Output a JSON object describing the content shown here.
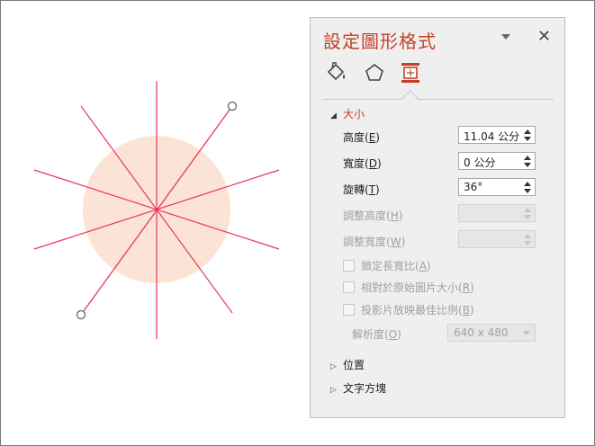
{
  "pane": {
    "title": "設定圖形格式",
    "menu_icon": "chevron-down-icon",
    "close_label": "✕"
  },
  "tabs": [
    {
      "name": "fill-line-icon"
    },
    {
      "name": "effects-pentagon-icon"
    },
    {
      "name": "size-properties-icon",
      "active": true
    }
  ],
  "sections": {
    "size": {
      "label": "大小",
      "height": {
        "label_prefix": "高度(",
        "key": "E",
        "label_suffix": ")",
        "value": "11.04 公分"
      },
      "width": {
        "label_prefix": "寬度(",
        "key": "D",
        "label_suffix": ")",
        "value": "0 公分"
      },
      "rotation": {
        "label_prefix": "旋轉(",
        "key": "T",
        "label_suffix": ")",
        "value": "36°"
      },
      "scale_height": {
        "label_prefix": "調整高度(",
        "key": "H",
        "label_suffix": ")",
        "value": ""
      },
      "scale_width": {
        "label_prefix": "調整寬度(",
        "key": "W",
        "label_suffix": ")",
        "value": ""
      },
      "lock_aspect": {
        "label_prefix": "鎖定長寬比(",
        "key": "A",
        "label_suffix": ")",
        "checked": false
      },
      "relative_original": {
        "label_prefix": "相對於原始圖片大小(",
        "key": "R",
        "label_suffix": ")",
        "checked": false
      },
      "best_scale": {
        "label_prefix": "投影片放映最佳比例(",
        "key": "B",
        "label_suffix": ")",
        "checked": false
      },
      "resolution": {
        "label_prefix": "解析度(",
        "key": "O",
        "label_suffix": ")",
        "value": "640 x 480"
      }
    },
    "position": {
      "label": "位置"
    },
    "text_box": {
      "label": "文字方塊"
    }
  },
  "colors": {
    "accent": "#c4402a",
    "circle_fill": "#fbe4d6",
    "line_color": "#e8365d",
    "handle": "#7a7a7a"
  }
}
